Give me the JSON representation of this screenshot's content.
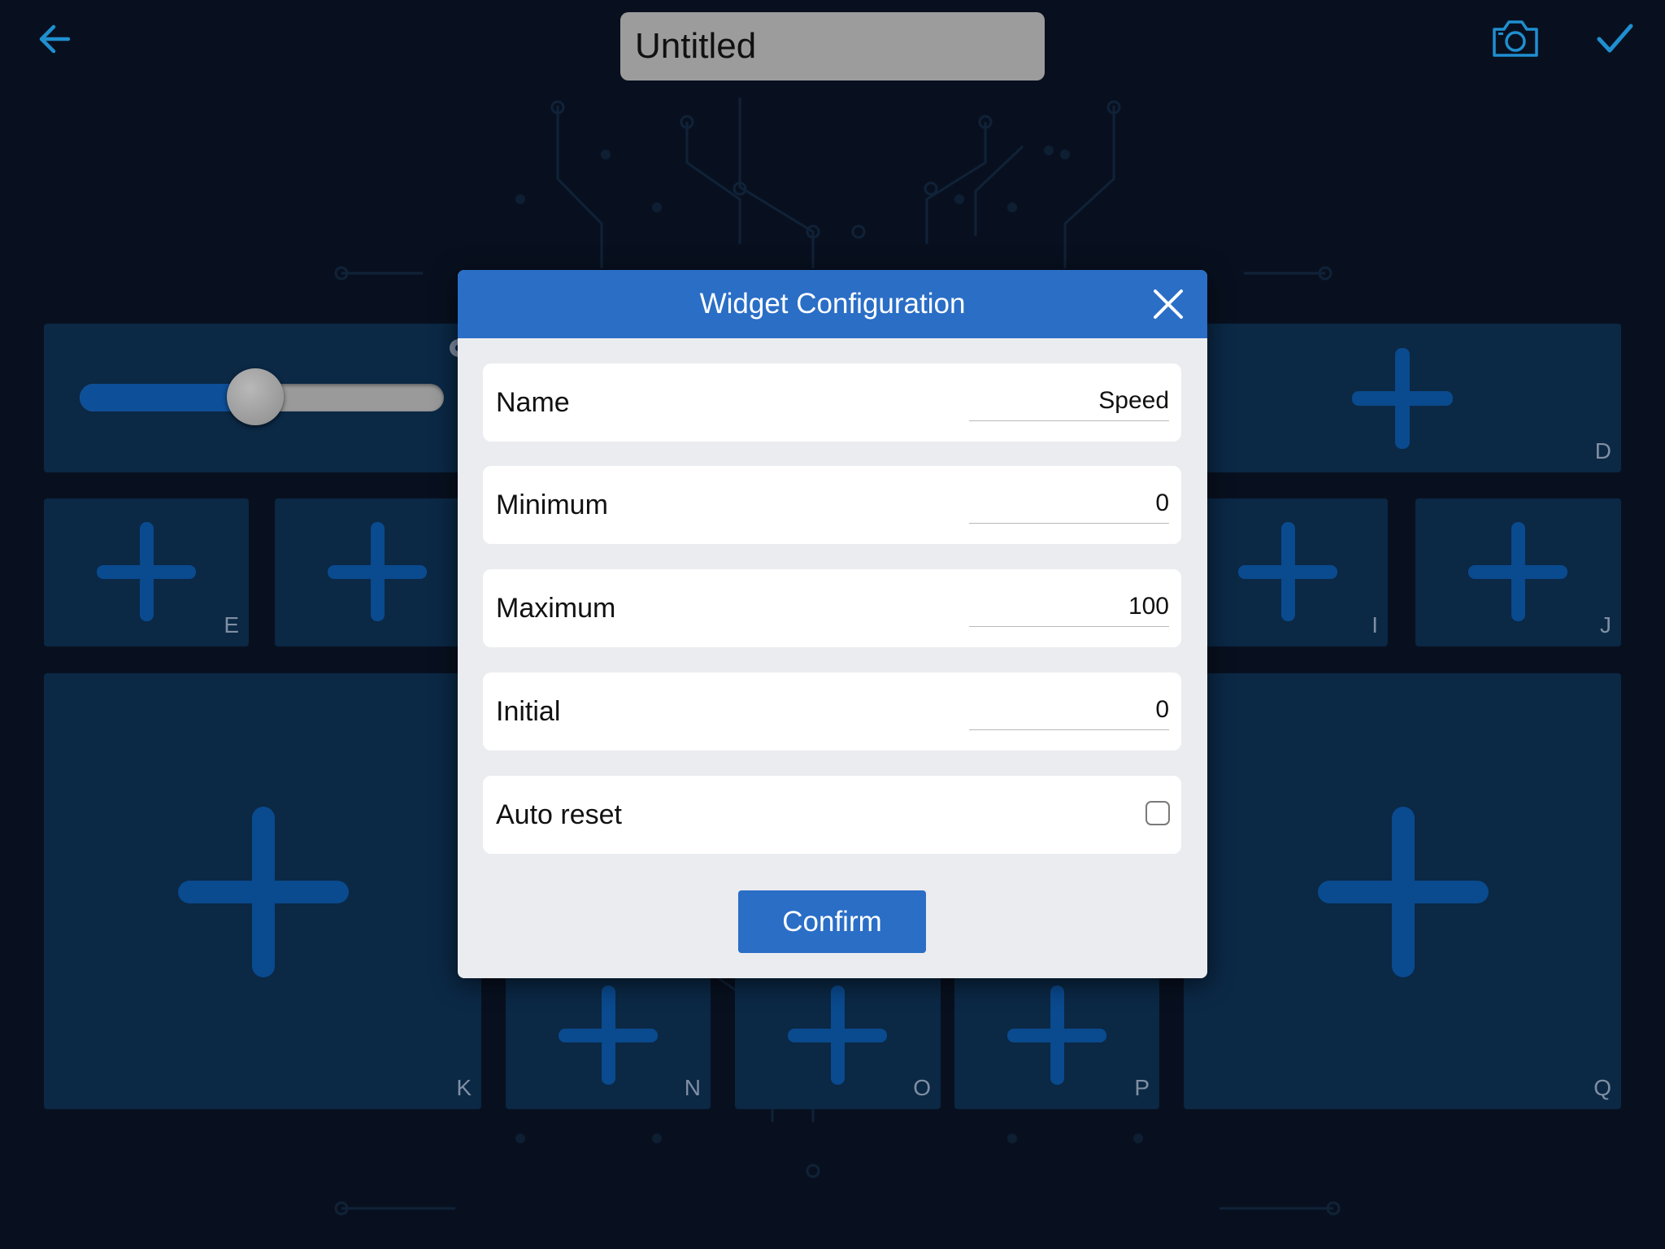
{
  "header": {
    "back_icon": "arrow-left-icon",
    "title_value": "Untitled",
    "camera_icon": "camera-icon",
    "check_icon": "checkmark-icon"
  },
  "colors": {
    "background": "#08101f",
    "tile": "#0b2845",
    "plus": "#0a4a8e",
    "accent": "#2a6ec6",
    "icon": "#1f8fd0"
  },
  "tiles": {
    "d": "D",
    "e": "E",
    "i": "I",
    "j": "J",
    "k": "K",
    "n": "N",
    "o": "O",
    "p": "P",
    "q": "Q"
  },
  "slider_widget": {
    "fraction": 0.46
  },
  "dialog": {
    "title": "Widget Configuration",
    "close_icon": "close-icon",
    "fields": {
      "name": {
        "label": "Name",
        "value": "Speed"
      },
      "minimum": {
        "label": "Minimum",
        "value": "0"
      },
      "maximum": {
        "label": "Maximum",
        "value": "100"
      },
      "initial": {
        "label": "Initial",
        "value": "0"
      },
      "auto_reset": {
        "label": "Auto reset",
        "checked": false
      }
    },
    "confirm_label": "Confirm"
  }
}
